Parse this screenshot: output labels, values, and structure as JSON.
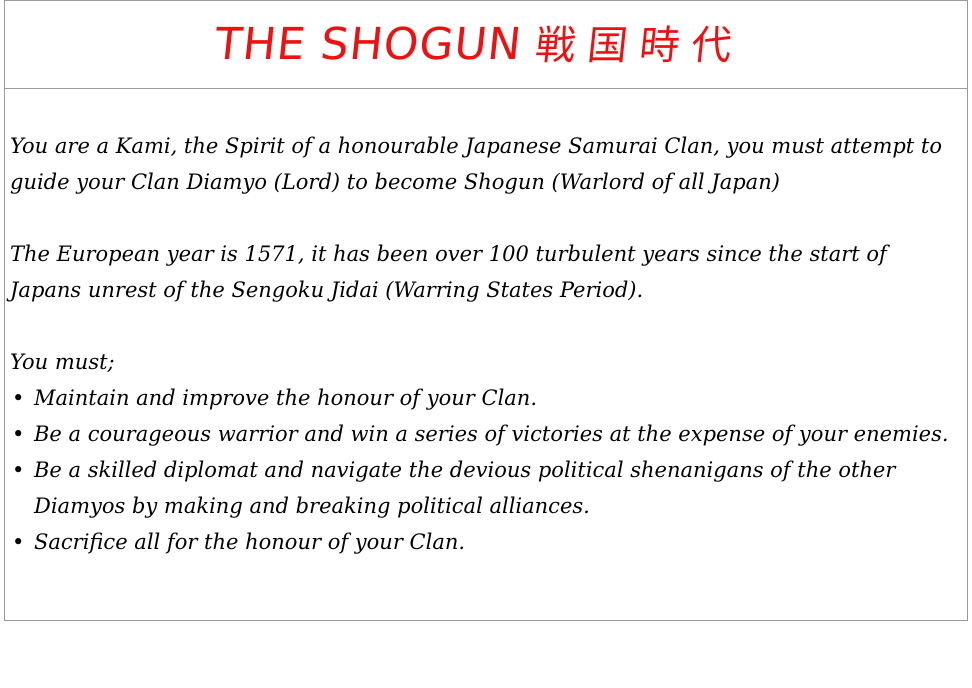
{
  "header": {
    "title": "THE SHOGUN",
    "kanji": "戦国時代"
  },
  "intro": {
    "paragraph1": "You are a Kami, the Spirit of a honourable Japanese Samurai Clan, you must attempt to guide your Clan Diamyo (Lord) to become Shogun (Warlord of all Japan)",
    "paragraph2": "The European year is 1571, it has been over 100 turbulent years since the start of Japans unrest of the Sengoku Jidai (Warring States Period).",
    "must_heading": "You must;"
  },
  "objectives": [
    {
      "bullet": "•",
      "text": "Maintain and improve the honour of your Clan."
    },
    {
      "bullet": "•",
      "text": "Be a courageous warrior and win a series of victories at the expense of your enemies."
    },
    {
      "bullet": "•",
      "text": "Be a skilled diplomat and navigate the devious political shenanigans of the other Diamyos by making and breaking political alliances."
    },
    {
      "bullet": "•",
      "text": "Sacrifice all for the honour of your Clan."
    }
  ],
  "colors": {
    "title": "#ee1111",
    "text": "#000000",
    "border": "#9a9a9a",
    "background": "#ffffff"
  }
}
